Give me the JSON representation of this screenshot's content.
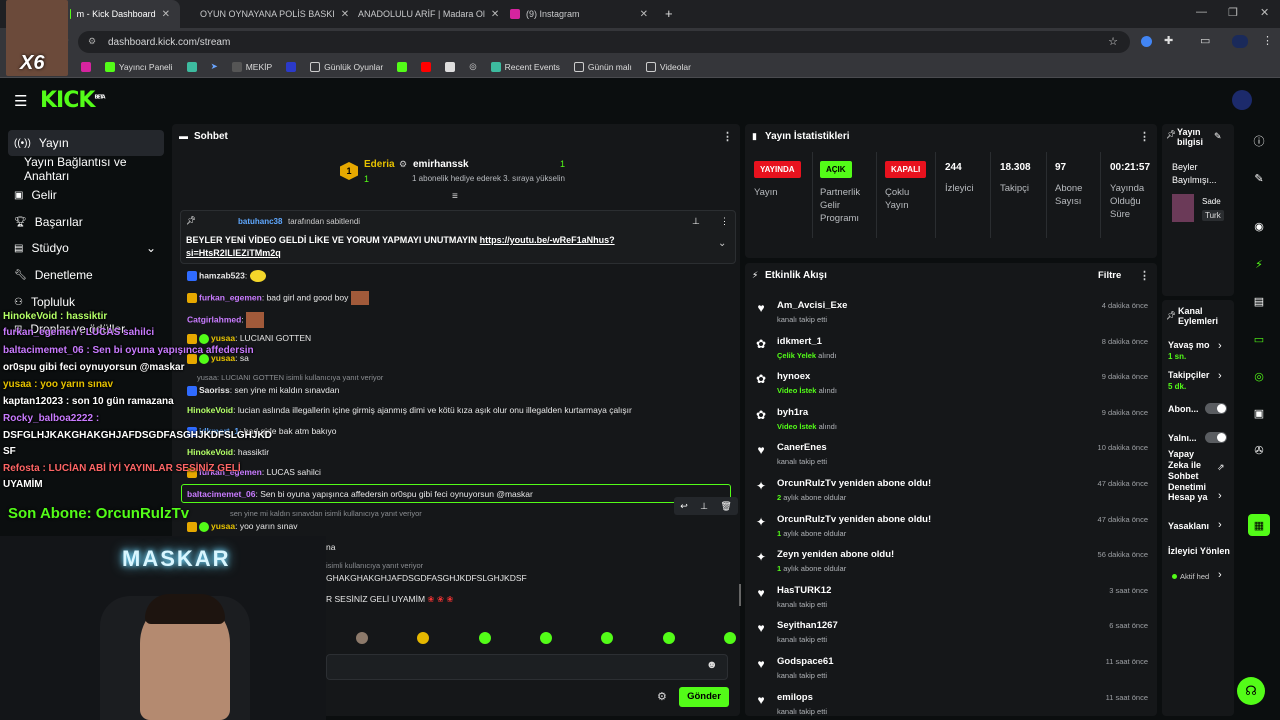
{
  "browser": {
    "tabs": [
      {
        "title": "m - Kick Dashboard"
      },
      {
        "title": "OYUN OYNAYANA POLİS BASKI"
      },
      {
        "title": "ANADOLULU ARİF | Madara Ol"
      },
      {
        "title": "(9) Instagram"
      }
    ],
    "url": "dashboard.kick.com/stream",
    "bookmarks": [
      "Yayıncı Paneli",
      "MEKİP",
      "Günlük Oyunlar",
      "Recent Events",
      "Günün malı",
      "Videolar"
    ]
  },
  "kick": {
    "logo": "KICK",
    "logo_beta": "BETA"
  },
  "sidebar": {
    "items": [
      {
        "label": "Yayın"
      },
      {
        "label": "Yayın Bağlantısı ve Anahtarı"
      },
      {
        "label": "Gelir"
      },
      {
        "label": "Başarılar"
      },
      {
        "label": "Stüdyo"
      },
      {
        "label": "Denetleme"
      },
      {
        "label": "Topluluk"
      },
      {
        "label": "Droplar ve ödüller"
      }
    ]
  },
  "chat": {
    "title": "Sohbet",
    "header_user1": "Ederia",
    "header_user1_count": "1",
    "header_user2": "emirhanssk",
    "header_user2_count": "1",
    "header_sub": "1 abonelik hediye ederek 3. sıraya yükselin",
    "pinned_by": "batuhanc38",
    "pinned_suffix": "tarafından sabitlendi",
    "pinned_text": "BEYLER YENİ VİDEO GELDİ LİKE VE YORUM YAPMAYI UNUTMAYIN",
    "pinned_link1": "https://youtu.be/-wReF1aNhus?",
    "pinned_link2": "si=HtsR2lLlEZiTMm2q",
    "messages": [
      {
        "user": "hamzab523",
        "text": ":",
        "color": "#e8e8e8"
      },
      {
        "user": "furkan_egemen",
        "text": ": bad girl and good boy",
        "color": "#c97bff"
      },
      {
        "user": "Catgirlahmed",
        "text": ":",
        "color": "#c97bff"
      },
      {
        "user": "yusaa",
        "text": ": LUCIANI GOTTEN",
        "color": "#e6c200"
      },
      {
        "user": "yusaa",
        "text": ": sa",
        "color": "#e6c200"
      },
      {
        "user": "Saoriss",
        "text": ": sen yine mi kaldın sınavdan",
        "color": "#e8e8e8"
      },
      {
        "user": "HinokeVoid",
        "text": ": lucian aslında illegallerin içine girmiş ajanmış dimi ve kötü kıza aşık olur onu illegalden kurtarmaya çalışır",
        "color": "#b3ff66"
      },
      {
        "user": "idkmert_1",
        "text": ": bad girle bak atm bakıyo",
        "color": "#5fa8ff"
      },
      {
        "user": "HinokeVoid",
        "text": ": hassiktir",
        "color": "#b3ff66"
      },
      {
        "user": "furkan_egemen",
        "text": ": LUCAS sahilci",
        "color": "#c97bff"
      },
      {
        "user": "baltacimemet_06",
        "text": ": Sen bi oyuna yapışınca affedersin or0spu gibi feci oynuyorsun @maskar",
        "color": "#c97bff"
      },
      {
        "user": "yusaa",
        "text": ": yoo yarın sınav",
        "color": "#e6c200"
      }
    ],
    "replies": [
      "yusaa: LUCIANI GOTTEN isimli kullanıcıya yanıt veriyor",
      "sen yine mi kaldın sınavdan isimli kullanıcıya yanıt veriyor",
      "isimli kullanıcıya yanıt veriyor"
    ],
    "partial_lines": [
      "na",
      "GHAKGHAKGHJAFDSGDFASGHJKDFSLGHJKDSF",
      "R SESİNİZ GELİ UYAMİM"
    ],
    "send_label": "Gönder"
  },
  "stats": {
    "title": "Yayın İstatistikleri",
    "live_badge": "YAYINDA",
    "live_label": "Yayın",
    "partner_badge": "AÇIK",
    "partner_label": "Partnerlik Gelir Programı",
    "multi_badge": "KAPALI",
    "multi_label": "Çoklu Yayın",
    "viewers": "244",
    "viewers_label": "İzleyici",
    "followers": "18.308",
    "followers_label": "Takipçi",
    "subs": "97",
    "subs_label": "Abone Sayısı",
    "uptime": "00:21:57",
    "uptime_label": "Yayında Olduğu Süre"
  },
  "activity": {
    "title": "Etkinlik Akışı",
    "filter": "Filtre",
    "items": [
      {
        "name": "Am_Avcisi_Exe",
        "sub": "kanalı takip etti",
        "sub_hl": "",
        "time": "4 dakika önce",
        "icon": "heart"
      },
      {
        "name": "idkmert_1",
        "sub": "alındı",
        "sub_hl": "Çelik Yelek",
        "time": "8 dakika önce",
        "icon": "gift"
      },
      {
        "name": "hynoex",
        "sub": "alındı",
        "sub_hl": "Video İstek",
        "time": "9 dakika önce",
        "icon": "gift"
      },
      {
        "name": "byh1ra",
        "sub": "alındı",
        "sub_hl": "Video İstek",
        "time": "9 dakika önce",
        "icon": "gift"
      },
      {
        "name": "CanerEnes",
        "sub": "kanalı takip etti",
        "sub_hl": "",
        "time": "10 dakika önce",
        "icon": "heart"
      },
      {
        "name": "OrcunRulzTv yeniden abone oldu!",
        "sub": "aylık abone oldular",
        "sub_hl": "2",
        "time": "47 dakika önce",
        "icon": "star"
      },
      {
        "name": "OrcunRulzTv yeniden abone oldu!",
        "sub": "aylık abone oldular",
        "sub_hl": "1",
        "time": "47 dakika önce",
        "icon": "star"
      },
      {
        "name": "Zeyn yeniden abone oldu!",
        "sub": "aylık abone oldular",
        "sub_hl": "1",
        "time": "56 dakika önce",
        "icon": "star"
      },
      {
        "name": "HasTURK12",
        "sub": "kanalı takip etti",
        "sub_hl": "",
        "time": "3 saat önce",
        "icon": "heart"
      },
      {
        "name": "Seyithan1267",
        "sub": "kanalı takip etti",
        "sub_hl": "",
        "time": "6 saat önce",
        "icon": "heart"
      },
      {
        "name": "Godspace61",
        "sub": "kanalı takip etti",
        "sub_hl": "",
        "time": "11 saat önce",
        "icon": "heart"
      },
      {
        "name": "emilops",
        "sub": "kanalı takip etti",
        "sub_hl": "",
        "time": "11 saat önce",
        "icon": "heart"
      }
    ]
  },
  "stream_info": {
    "title": "Yayın bilgisi",
    "line1": "Beyler Bayılmışı...",
    "cat1": "Sade",
    "cat2": "Turk"
  },
  "channel_actions": {
    "title": "Kanal Eylemleri",
    "slow_mode": "Yavaş mo",
    "slow_value": "1 sn.",
    "followers_mode": "Takipçiler",
    "followers_value": "5 dk.",
    "subs_mode": "Abon...",
    "links_mode": "Yalnı...",
    "ai_mod": "Yapay Zeka ile Sohbet Denetimi",
    "account_age": "Hesap ya",
    "bans": "Yasaklanı",
    "viewer_manage": "İzleyici Yönlen",
    "active": "Aktif hed"
  },
  "overlay": {
    "lines": [
      {
        "text": "HinokeVoid : hassiktir",
        "color": "#b3ff66"
      },
      {
        "text": "furkan_egemen : LUCAS sahilci",
        "color": "#c97bff"
      },
      {
        "text": "baltacimemet_06 : Sen bi oyuna yapışınca affedersin",
        "color": "#c97bff"
      },
      {
        "text": "or0spu gibi feci oynuyorsun @maskar",
        "color": "#ffffff"
      },
      {
        "text": "yusaa : yoo yarın sınav",
        "color": "#e6c200"
      },
      {
        "text": "kaptan12023 : son 10 gün ramazana",
        "color": "#ffffff"
      },
      {
        "text": "Rocky_balboa2222 :",
        "color": "#c97bff"
      },
      {
        "text": "DSFGLHJKAKGHAKGHJAFDSGDFASGHJKDFSLGHJKD",
        "color": "#ffffff"
      },
      {
        "text": "SF",
        "color": "#ffffff"
      },
      {
        "text": "Refosta : LUCİAN ABİ İYİ YAYINLAR SESİNİZ GELİ",
        "color": "#ff6666"
      },
      {
        "text": "UYAMİM",
        "color": "#ffffff"
      }
    ],
    "last_sub": "Son Abone: OrcunRulzTv",
    "cam_name": "MASKAR",
    "face_cam_tag": "X6"
  },
  "colors": {
    "accent": "#53fc18",
    "live_red": "#e8121e"
  }
}
